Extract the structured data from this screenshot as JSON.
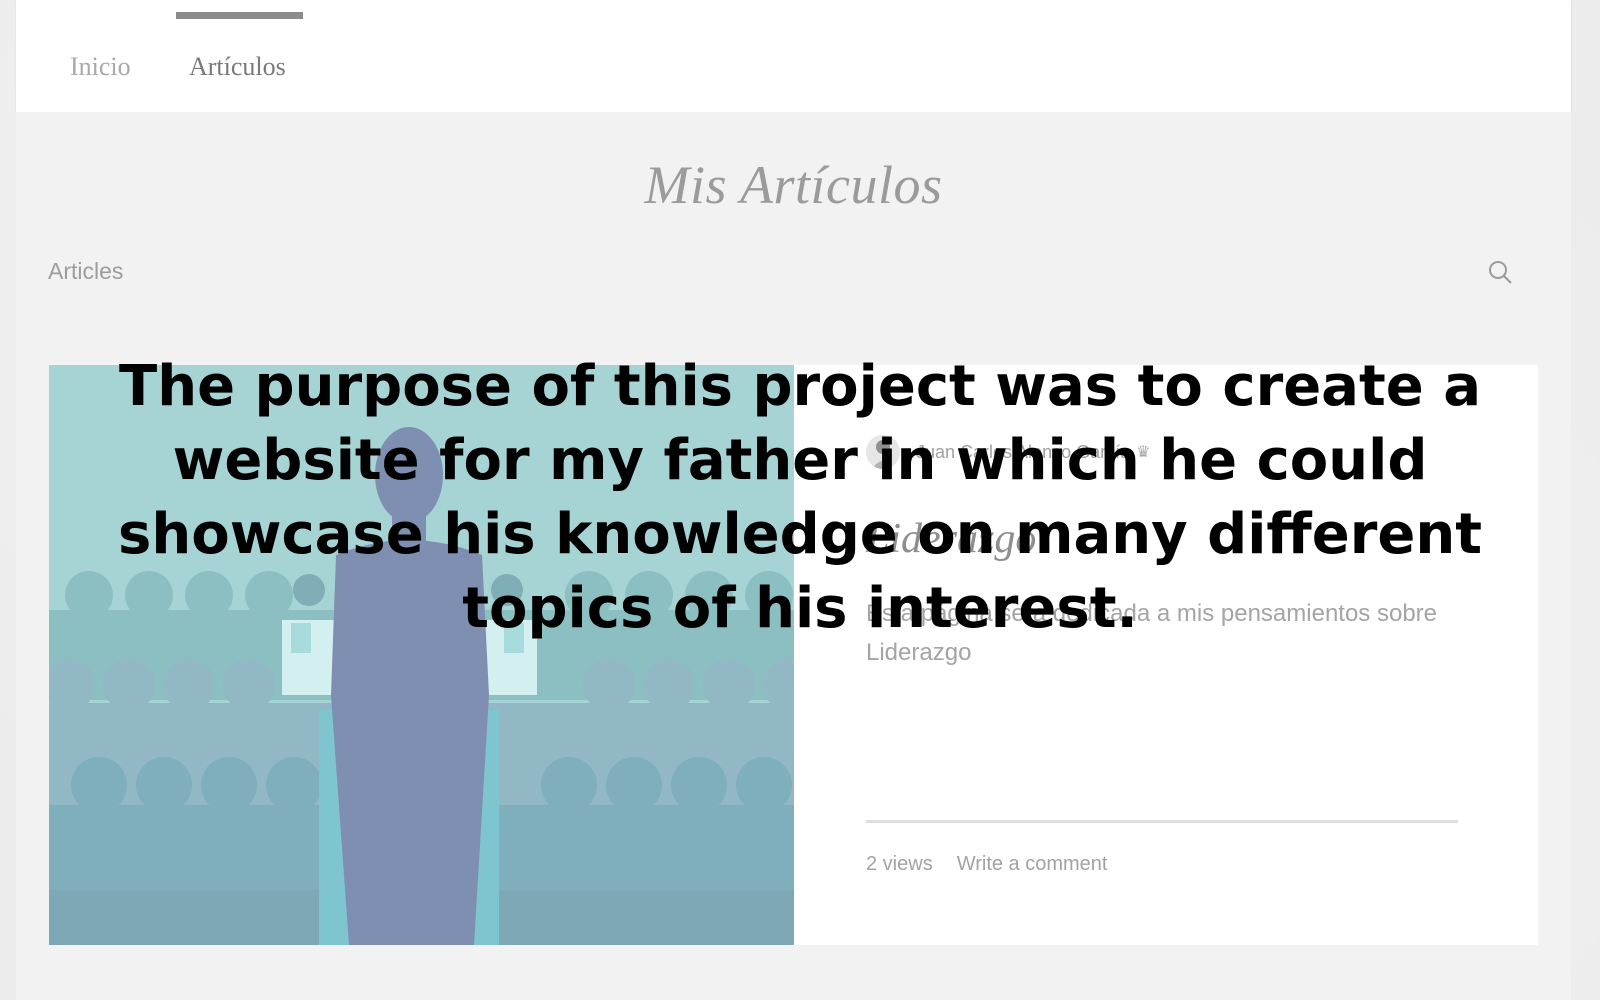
{
  "header": {
    "nav": [
      {
        "label": "Inicio",
        "active": false
      },
      {
        "label": "Artículos",
        "active": true
      }
    ]
  },
  "main": {
    "page_title": "Mis Artículos",
    "blog_label": "Articles",
    "search_icon": "search-icon"
  },
  "post": {
    "author": "Juan Carlos Alonso García",
    "date_label": "",
    "title": "Liderazgo",
    "excerpt": "Esta página sera dedicada a mis pensamientos sobre Liderazgo",
    "views": "2 views",
    "comment_label": "Write a comment"
  },
  "overlay": {
    "text": "The purpose of this project was to create a website for my father in which he could showcase his knowledge on many different topics of his interest."
  },
  "colors": {
    "image_bg": "#a6d4d4",
    "speaker": "#7f8fb1",
    "podium": "#7ec5cf"
  }
}
